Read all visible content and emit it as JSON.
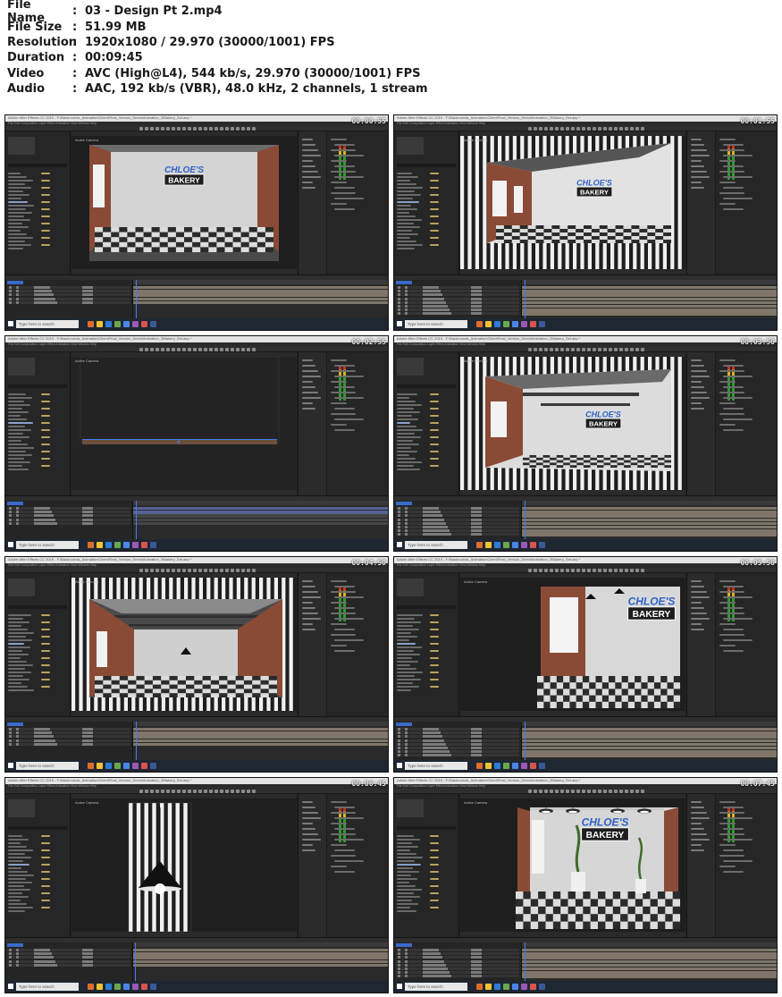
{
  "metadata": [
    {
      "key": "File Name",
      "sep": ":",
      "value": "03 - Design Pt 2.mp4"
    },
    {
      "key": "File Size",
      "sep": ":",
      "value": "51.99 MB"
    },
    {
      "key": "Resolution",
      "sep": ":",
      "value": "1920x1080 / 29.970 (30000/1001) FPS"
    },
    {
      "key": "Duration",
      "sep": ":",
      "value": "00:09:45"
    },
    {
      "key": "Video",
      "sep": ":",
      "value": "AVC (High@L4), 544 kb/s, 29.970 (30000/1001) FPS"
    },
    {
      "key": "Audio",
      "sep": ":",
      "value": "AAC, 192 kb/s (VBR), 48.0 kHz, 2 channels, 1 stream"
    }
  ],
  "app": {
    "window_title": "Adobe After Effects CC 2019 - F:\\Backrounds_Animation\\Client\\Final_Version_Direct\\Animation_3\\Bakery_Set.aep *",
    "menu": "File   Edit   Composition   Layer   Effect   Animation   View   Window   Help",
    "viewer_label": "Active Camera",
    "search_placeholder": "Type here to search",
    "sign_top": "CHLOE'S",
    "sign_bottom": "BAKERY"
  },
  "thumbnails": [
    {
      "timestamp": "00:00:55",
      "scene": "room-front"
    },
    {
      "timestamp": "00:01:55",
      "scene": "room-angle"
    },
    {
      "timestamp": "00:02:55",
      "scene": "floor-plank"
    },
    {
      "timestamp": "00:03:50",
      "scene": "room-beams"
    },
    {
      "timestamp": "00:04:50",
      "scene": "room-deep"
    },
    {
      "timestamp": "00:05:50",
      "scene": "wall-close"
    },
    {
      "timestamp": "00:06:45",
      "scene": "lamp"
    },
    {
      "timestamp": "00:07:45",
      "scene": "room-final"
    }
  ],
  "colors": {
    "ae_blue": "#3f7cf3",
    "sign_blue": "#2f63c8",
    "sign_dark": "#1e1e1e",
    "brick": "#8a4b36"
  }
}
